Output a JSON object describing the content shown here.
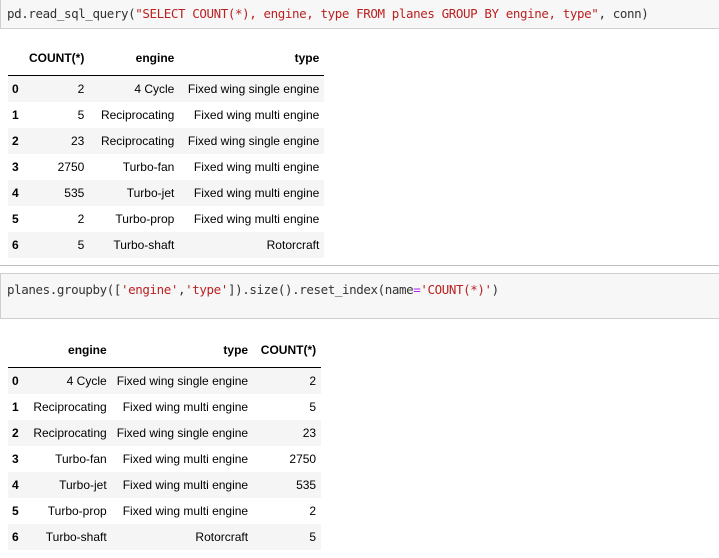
{
  "cells": [
    {
      "code_tokens": [
        {
          "t": "pd.read_sql_query(",
          "c": ""
        },
        {
          "t": "\"SELECT COUNT(*), engine, type FROM planes GROUP BY engine, type\"",
          "c": "str"
        },
        {
          "t": ", conn)",
          "c": ""
        }
      ],
      "table": {
        "columns": [
          "",
          "COUNT(*)",
          "engine",
          "type"
        ],
        "rows": [
          [
            "0",
            "2",
            "4 Cycle",
            "Fixed wing single engine"
          ],
          [
            "1",
            "5",
            "Reciprocating",
            "Fixed wing multi engine"
          ],
          [
            "2",
            "23",
            "Reciprocating",
            "Fixed wing single engine"
          ],
          [
            "3",
            "2750",
            "Turbo-fan",
            "Fixed wing multi engine"
          ],
          [
            "4",
            "535",
            "Turbo-jet",
            "Fixed wing multi engine"
          ],
          [
            "5",
            "2",
            "Turbo-prop",
            "Fixed wing multi engine"
          ],
          [
            "6",
            "5",
            "Turbo-shaft",
            "Rotorcraft"
          ]
        ]
      }
    },
    {
      "code_tokens": [
        {
          "t": "planes.groupby([",
          "c": ""
        },
        {
          "t": "'engine'",
          "c": "str"
        },
        {
          "t": ",",
          "c": ""
        },
        {
          "t": "'type'",
          "c": "str"
        },
        {
          "t": "]).size().reset_index(name",
          "c": ""
        },
        {
          "t": "=",
          "c": "op"
        },
        {
          "t": "'COUNT(*)'",
          "c": "str"
        },
        {
          "t": ")",
          "c": ""
        }
      ],
      "table": {
        "columns": [
          "",
          "engine",
          "type",
          "COUNT(*)"
        ],
        "rows": [
          [
            "0",
            "4 Cycle",
            "Fixed wing single engine",
            "2"
          ],
          [
            "1",
            "Reciprocating",
            "Fixed wing multi engine",
            "5"
          ],
          [
            "2",
            "Reciprocating",
            "Fixed wing single engine",
            "23"
          ],
          [
            "3",
            "Turbo-fan",
            "Fixed wing multi engine",
            "2750"
          ],
          [
            "4",
            "Turbo-jet",
            "Fixed wing multi engine",
            "535"
          ],
          [
            "5",
            "Turbo-prop",
            "Fixed wing multi engine",
            "2"
          ],
          [
            "6",
            "Turbo-shaft",
            "Rotorcraft",
            "5"
          ]
        ]
      }
    }
  ]
}
